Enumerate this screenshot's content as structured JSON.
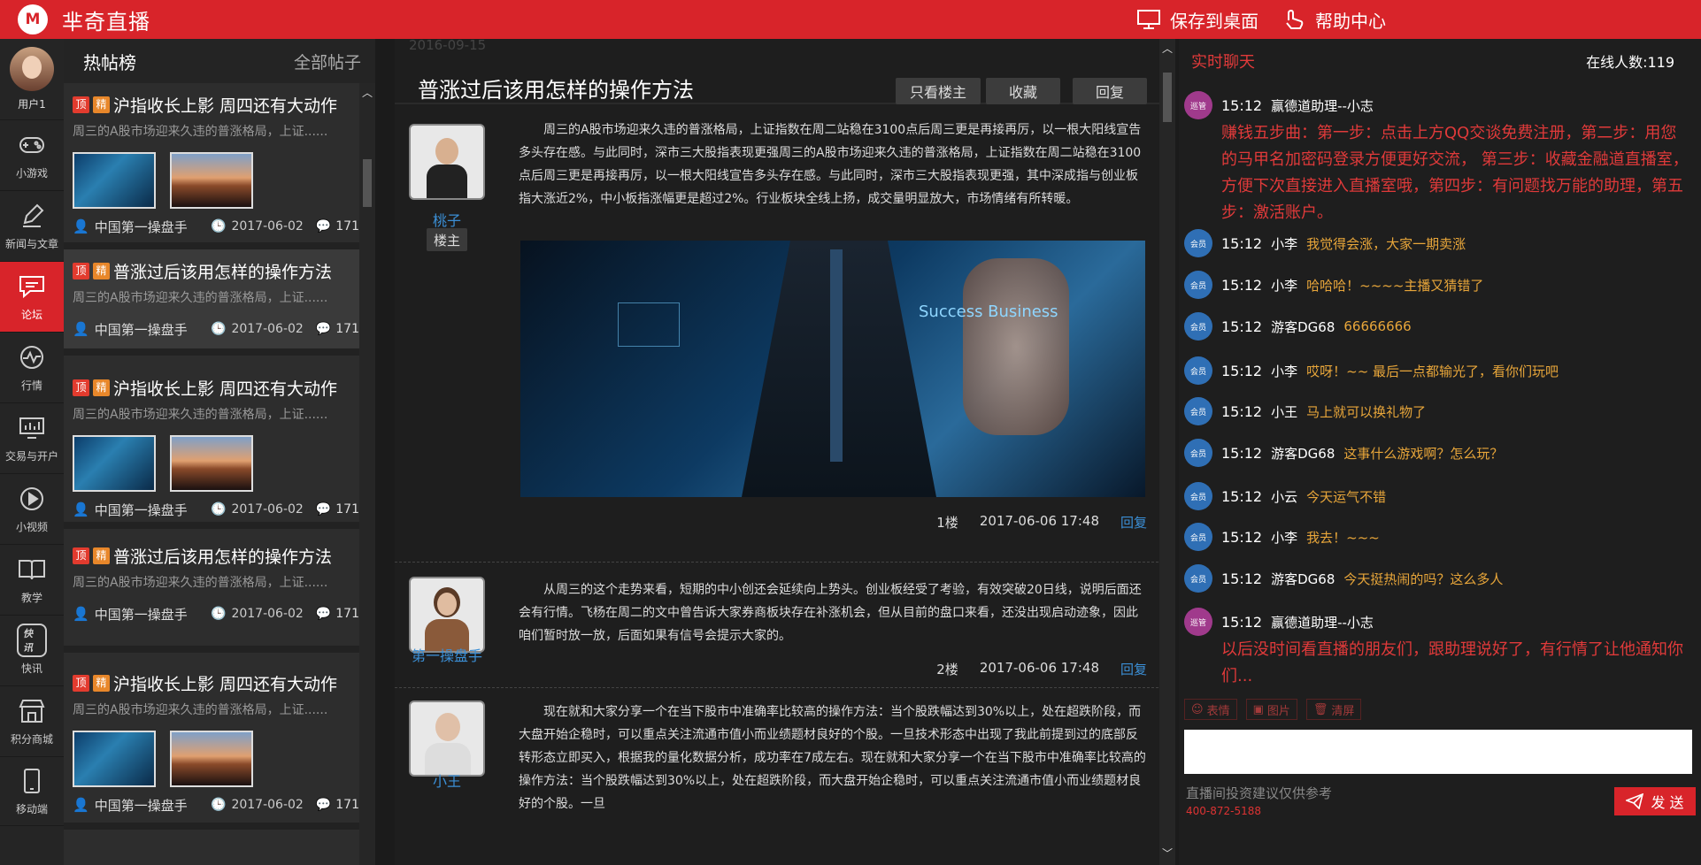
{
  "app": {
    "title": "芈奇直播",
    "logo_letter": "M"
  },
  "header": {
    "save_desktop": "保存到桌面",
    "help": "帮助中心"
  },
  "nav": {
    "user": "用户1",
    "items": [
      {
        "label": "小游戏",
        "icon": "gamepad-icon"
      },
      {
        "label": "新闻与文章",
        "icon": "pen-icon"
      },
      {
        "label": "论坛",
        "icon": "chat-bubble-icon",
        "active": true
      },
      {
        "label": "行情",
        "icon": "pulse-icon"
      },
      {
        "label": "交易与开户",
        "icon": "monitor-chart-icon"
      },
      {
        "label": "小视频",
        "icon": "play-icon"
      },
      {
        "label": "教学",
        "icon": "book-icon"
      },
      {
        "label": "快讯",
        "icon": "flash-news-icon",
        "badge": "快讯"
      },
      {
        "label": "积分商城",
        "icon": "shop-icon"
      },
      {
        "label": "移动端",
        "icon": "mobile-icon"
      }
    ]
  },
  "posts": {
    "hot": "热帖榜",
    "all": "全部帖子",
    "tag_top": "顶",
    "tag_best": "精",
    "items": [
      {
        "title": "沪指收长上影 周四还有大动作",
        "excerpt": "周三的A股市场迎来久违的普涨格局，上证......",
        "author": "中国第一操盘手",
        "date": "2017-06-02",
        "comments": "171"
      },
      {
        "title": "普涨过后该用怎样的操作方法",
        "excerpt": "周三的A股市场迎来久违的普涨格局，上证......",
        "author": "中国第一操盘手",
        "date": "2017-06-02",
        "comments": "171"
      },
      {
        "title": "沪指收长上影 周四还有大动作",
        "excerpt": "周三的A股市场迎来久违的普涨格局，上证......",
        "author": "中国第一操盘手",
        "date": "2017-06-02",
        "comments": "171"
      },
      {
        "title": "普涨过后该用怎样的操作方法",
        "excerpt": "周三的A股市场迎来久违的普涨格局，上证......",
        "author": "中国第一操盘手",
        "date": "2017-06-02",
        "comments": "171"
      },
      {
        "title": "沪指收长上影 周四还有大动作",
        "excerpt": "周三的A股市场迎来久违的普涨格局，上证......",
        "author": "中国第一操盘手",
        "date": "2017-06-02",
        "comments": "171"
      }
    ]
  },
  "thread": {
    "date": "2016-09-15",
    "title": "普涨过后该用怎样的操作方法",
    "btn_owner": "只看楼主",
    "btn_fav": "收藏",
    "btn_reply": "回复",
    "reply": "回复",
    "floors": [
      {
        "name": "桃子",
        "badge": "楼主",
        "text": "周三的A股市场迎来久违的普涨格局，上证指数在周二站稳在3100点后周三更是再接再厉，以一根大阳线宣告多头存在感。与此同时，深市三大股指表现更强周三的A股市场迎来久违的普涨格局，上证指数在周二站稳在3100点后周三更是再接再厉，以一根大阳线宣告多头存在感。与此同时，深市三大股指表现更强，其中深成指与创业板指大涨近2%，中小板指涨幅更是超过2%。行业板块全线上扬，成交量明显放大，市场情绪有所转暖。",
        "floor": "1楼",
        "time": "2017-06-06 17:48",
        "img_text": "Success Business"
      },
      {
        "name": "第一操盘手",
        "text": "从周三的这个走势来看，短期的中小创还会延续向上势头。创业板经受了考验，有效突破20日线，说明后面还会有行情。飞杨在周二的文中曾告诉大家券商板块存在补涨机会，但从目前的盘口来看，还没出现启动迹象，因此咱们暂时放一放，后面如果有信号会提示大家的。",
        "floor": "2楼",
        "time": "2017-06-06 17:48"
      },
      {
        "name": "小王",
        "text": "现在就和大家分享一个在当下股市中准确率比较高的操作方法：当个股跌幅达到30%以上，处在超跌阶段，而大盘开始企稳时，可以重点关注流通市值小而业绩题材良好的个股。一旦技术形态中出现了我此前提到过的底部反转形态立即买入，根据我的量化数据分析，成功率在7成左右。现在就和大家分享一个在当下股市中准确率比较高的操作方法：当个股跌幅达到30%以上，处在超跌阶段，而大盘开始企稳时，可以重点关注流通市值小而业绩题材良好的个股。一旦"
      }
    ]
  },
  "chat": {
    "title": "实时聊天",
    "online": "在线人数:119",
    "badge_patrol": "巡管",
    "badge_member": "会员",
    "messages": [
      {
        "role": "patrol",
        "time": "15:12",
        "name": "赢德道助理--小志",
        "text": "赚钱五步曲：第一步：点击上方QQ交谈免费注册，第二步：用您的马甲名加密码登录方便更好交流， 第三步：收藏金融道直播室，方便下次直接进入直播室哦，第四步：有问题找万能的助理，第五步：激活账户。"
      },
      {
        "role": "member",
        "time": "15:12",
        "name": "小李",
        "text": "我觉得会涨，大家一期卖涨"
      },
      {
        "role": "member",
        "time": "15:12",
        "name": "小李",
        "text": "哈哈哈！~~~~主播又猜错了"
      },
      {
        "role": "member",
        "time": "15:12",
        "name": "游客DG68",
        "text": "66666666"
      },
      {
        "role": "member",
        "time": "15:12",
        "name": "小李",
        "text": "哎呀！~~ 最后一点都输光了，看你们玩吧"
      },
      {
        "role": "member",
        "time": "15:12",
        "name": "小王",
        "text": "马上就可以换礼物了"
      },
      {
        "role": "member",
        "time": "15:12",
        "name": "游客DG68",
        "text": "这事什么游戏啊？怎么玩？"
      },
      {
        "role": "member",
        "time": "15:12",
        "name": "小云",
        "text": "今天运气不错"
      },
      {
        "role": "member",
        "time": "15:12",
        "name": "小李",
        "text": "我去！~~~"
      },
      {
        "role": "member",
        "time": "15:12",
        "name": "游客DG68",
        "text": "今天挺热闹的吗？这么多人"
      },
      {
        "role": "patrol",
        "time": "15:12",
        "name": "赢德道助理--小志",
        "text": "以后没时间看直播的朋友们，跟助理说好了，有行情了让他通知你们..."
      }
    ],
    "tools": [
      "表情",
      "图片",
      "清屏"
    ],
    "note": "直播间投资建议仅供参考",
    "phone": "400-872-5188",
    "send": "发 送"
  },
  "colors": {
    "brand": "#d8242a",
    "link": "#3b8fd6",
    "chat_text": "#e8a63a"
  }
}
